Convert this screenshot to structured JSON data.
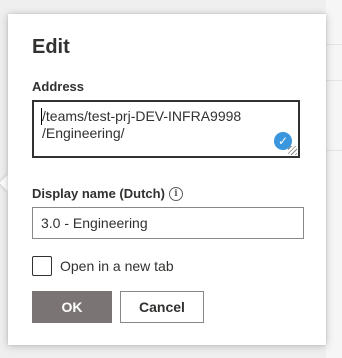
{
  "dialog": {
    "title": "Edit",
    "address": {
      "label": "Address",
      "value": "/teams/test-prj-DEV-INFRA9998\n/Engineering/"
    },
    "display_name": {
      "label": "Display name (Dutch)",
      "info_icon": "info-icon",
      "value": "3.0 - Engineering"
    },
    "open_new_tab": {
      "label": "Open in a new tab",
      "checked": false
    },
    "buttons": {
      "ok": "OK",
      "cancel": "Cancel"
    }
  },
  "colors": {
    "validation_badge": "#3a96dd",
    "ok_button": "#7a7574",
    "border_dark": "#323130"
  }
}
